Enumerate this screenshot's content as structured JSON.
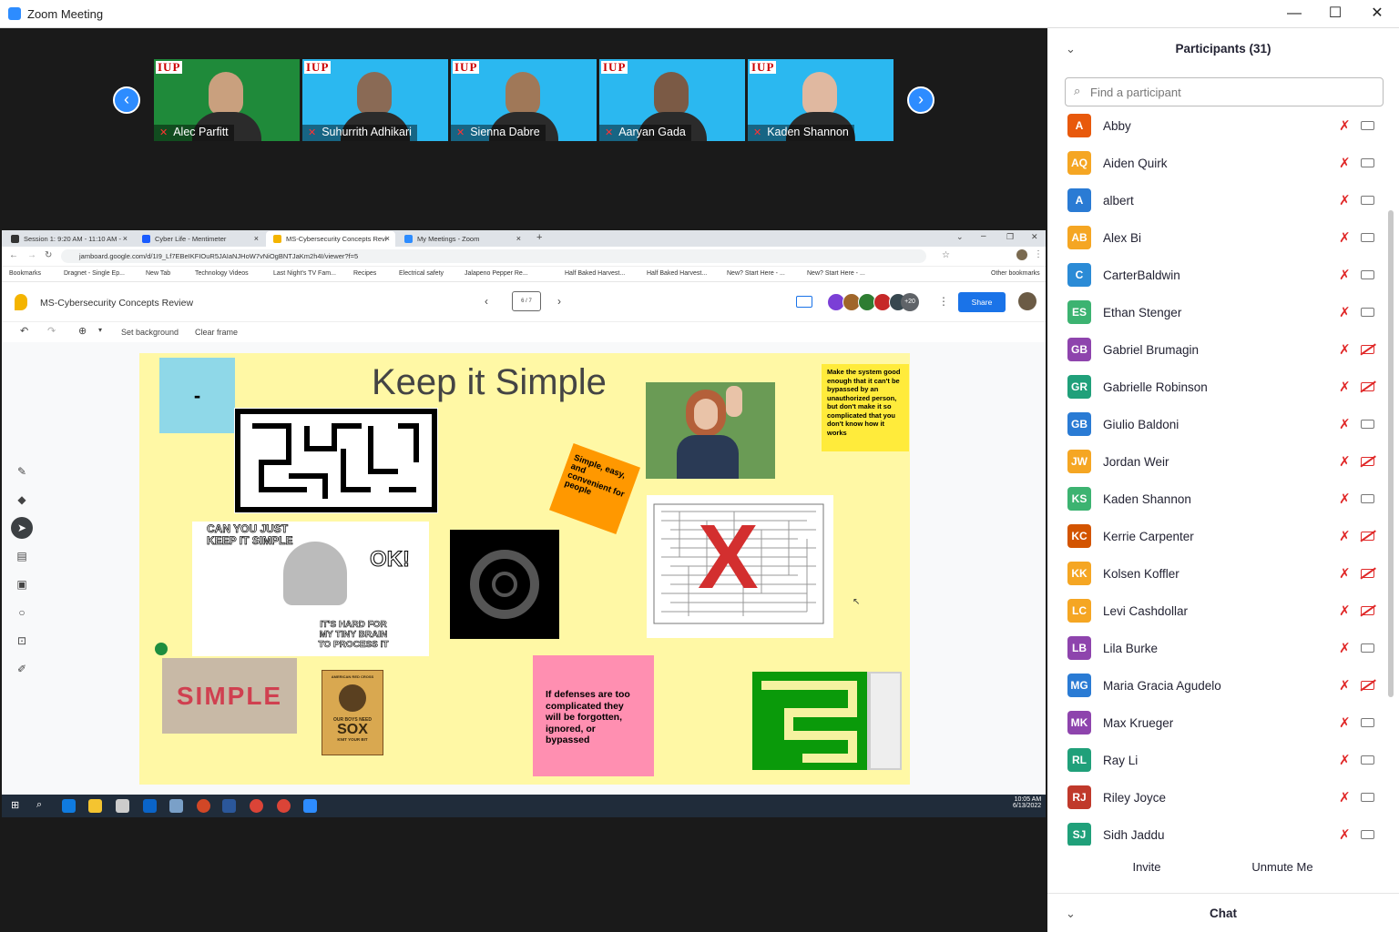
{
  "window": {
    "title": "Zoom Meeting",
    "minimize": "—",
    "maximize": "☐",
    "close": "✕"
  },
  "gallery": {
    "prev": "‹",
    "next": "›",
    "logo": "IUP",
    "tiles": [
      {
        "name": "Alec Parfitt",
        "bg": "#1f8a3a",
        "head": "#c9a07e"
      },
      {
        "name": "Suhurrith Adhikari",
        "bg": "#2bb8f0",
        "head": "#8a6a55"
      },
      {
        "name": "Sienna Dabre",
        "bg": "#2bb8f0",
        "head": "#a07858"
      },
      {
        "name": "Aaryan Gada",
        "bg": "#2bb8f0",
        "head": "#7b5a45"
      },
      {
        "name": "Kaden Shannon",
        "bg": "#2bb8f0",
        "head": "#e0b8a0"
      }
    ]
  },
  "browser": {
    "tabs": [
      {
        "label": "Session 1: 9:20 AM - 11:10 AM -",
        "color": "#333"
      },
      {
        "label": "Cyber Life - Mentimeter",
        "color": "#1a5cff"
      },
      {
        "label": "MS-Cybersecurity Concepts Revi",
        "color": "#f4b400"
      },
      {
        "label": "My Meetings - Zoom",
        "color": "#2d8cff"
      }
    ],
    "new_tab": "+",
    "url": "jamboard.google.com/d/1I9_Lf7EBeIKFIOuR5JAIaNJHoW7vNiOgBNTJaKm2h4I/viewer?f=5",
    "bookmarks": [
      "Bookmarks",
      "Dragnet - Single Ep...",
      "New Tab",
      "Technology Videos",
      "Last Night's TV Fam...",
      "Recipes",
      "Electrical safety",
      "Jalapeno Pepper Re...",
      "Half Baked Harvest...",
      "Half Baked Harvest...",
      "New? Start Here - ...",
      "New? Start Here - ..."
    ],
    "other_bookmarks": "Other bookmarks"
  },
  "jamboard": {
    "title": "MS-Cybersecurity Concepts Review",
    "frame_counter": "6 / 7",
    "avatars_more": "+20",
    "share_label": "Share",
    "set_background": "Set background",
    "clear_frame": "Clear frame",
    "frame": {
      "heading": "Keep it Simple",
      "dash": "-",
      "orange_note": "Simple, easy, and convenient for people",
      "yellow_note": "Make the system good enough that it can't be bypassed by an unauthorized person, but don't make it so complicated that you don't know how it works",
      "pink_note": "If defenses are too complicated they will be forgotten, ignored, or bypassed",
      "meme_top": "CAN YOU JUST KEEP IT SIMPLE",
      "meme_ok": "OK!",
      "meme_bottom": "IT'S HARD FOR MY TINY BRAIN TO PROCESS IT",
      "simple_word": "SIMPLE",
      "poster_top": "AMERICAN RED CROSS",
      "poster_mid": "OUR BOYS NEED",
      "poster_big": "SOX",
      "poster_bottom": "KNIT YOUR BIT",
      "maze_x": "X"
    }
  },
  "taskbar": {
    "time": "10:05 AM",
    "date": "6/13/2022"
  },
  "participants": {
    "title": "Participants (31)",
    "search_placeholder": "Find a participant",
    "list": [
      {
        "initials": "A",
        "name": "Abby",
        "color": "#e8590c",
        "video_off": false
      },
      {
        "initials": "AQ",
        "name": "Aiden Quirk",
        "color": "#f5a623",
        "video_off": false
      },
      {
        "initials": "A",
        "name": "albert",
        "color": "#2a7bd4",
        "video_off": false
      },
      {
        "initials": "AB",
        "name": "Alex Bi",
        "color": "#f5a623",
        "video_off": false
      },
      {
        "initials": "C",
        "name": "CarterBaldwin",
        "color": "#2b8bd6",
        "video_off": false
      },
      {
        "initials": "ES",
        "name": "Ethan Stenger",
        "color": "#3cb371",
        "video_off": false
      },
      {
        "initials": "GB",
        "name": "Gabriel Brumagin",
        "color": "#8e44ad",
        "video_off": true
      },
      {
        "initials": "GR",
        "name": "Gabrielle Robinson",
        "color": "#20a07a",
        "video_off": true
      },
      {
        "initials": "GB",
        "name": "Giulio Baldoni",
        "color": "#2a7bd4",
        "video_off": false
      },
      {
        "initials": "JW",
        "name": "Jordan Weir",
        "color": "#f5a623",
        "video_off": true
      },
      {
        "initials": "KS",
        "name": "Kaden Shannon",
        "color": "#3cb371",
        "video_off": false
      },
      {
        "initials": "KC",
        "name": "Kerrie Carpenter",
        "color": "#d35400",
        "video_off": true
      },
      {
        "initials": "KK",
        "name": "Kolsen Koffler",
        "color": "#f5a623",
        "video_off": true
      },
      {
        "initials": "LC",
        "name": "Levi Cashdollar",
        "color": "#f5a623",
        "video_off": true
      },
      {
        "initials": "LB",
        "name": "Lila Burke",
        "color": "#8e44ad",
        "video_off": false
      },
      {
        "initials": "MG",
        "name": "Maria Gracia Agudelo",
        "color": "#2a7bd4",
        "video_off": true
      },
      {
        "initials": "MK",
        "name": "Max Krueger",
        "color": "#8e44ad",
        "video_off": false
      },
      {
        "initials": "RL",
        "name": "Ray Li",
        "color": "#20a07a",
        "video_off": false
      },
      {
        "initials": "RJ",
        "name": "Riley Joyce",
        "color": "#c0392b",
        "video_off": false
      },
      {
        "initials": "SJ",
        "name": "Sidh Jaddu",
        "color": "#20a07a",
        "video_off": false
      }
    ],
    "invite": "Invite",
    "unmute": "Unmute Me"
  },
  "chat": {
    "title": "Chat"
  }
}
